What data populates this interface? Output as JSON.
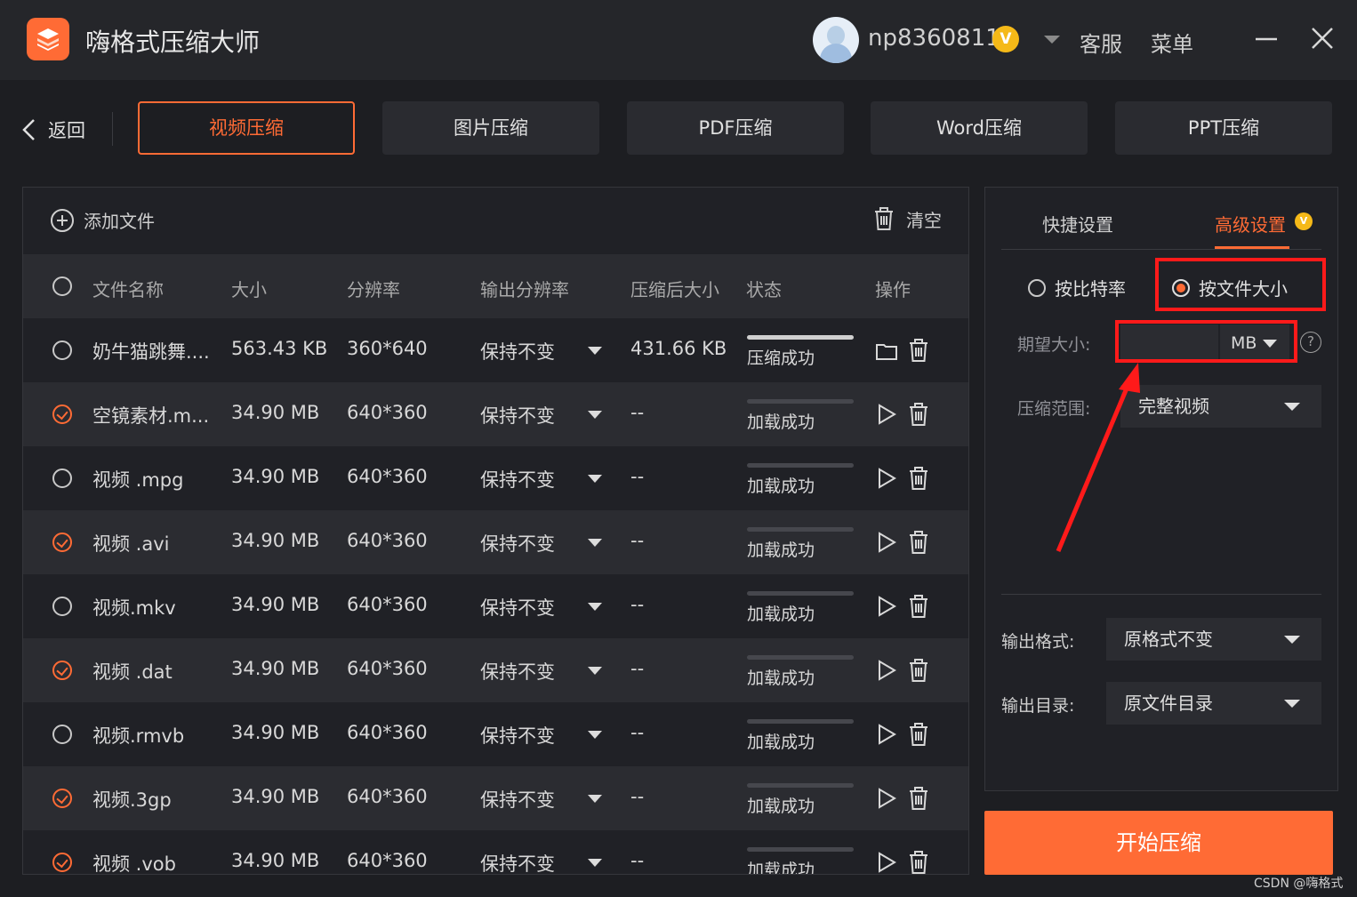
{
  "app": {
    "title": "嗨格式压缩大师"
  },
  "user": {
    "name": "np8360811",
    "vip_badge": "V",
    "service_label": "客服",
    "menu_label": "菜单"
  },
  "nav": {
    "back_label": "返回",
    "tabs": [
      {
        "label": "视频压缩",
        "active": true
      },
      {
        "label": "图片压缩",
        "active": false
      },
      {
        "label": "PDF压缩",
        "active": false
      },
      {
        "label": "Word压缩",
        "active": false
      },
      {
        "label": "PPT压缩",
        "active": false
      }
    ]
  },
  "file_panel": {
    "add_label": "添加文件",
    "clear_label": "清空",
    "columns": [
      "文件名称",
      "大小",
      "分辨率",
      "输出分辨率",
      "压缩后大小",
      "状态",
      "操作"
    ],
    "rows": [
      {
        "name": "奶牛猫跳舞....",
        "size": "563.43 KB",
        "resolution": "360*640",
        "output_resolution": "保持不变",
        "compressed_size": "431.66 KB",
        "status": "压缩成功",
        "checked": false
      },
      {
        "name": "空镜素材.m...",
        "size": "34.90 MB",
        "resolution": "640*360",
        "output_resolution": "保持不变",
        "compressed_size": "--",
        "status": "加载成功",
        "checked": true
      },
      {
        "name": "视频 .mpg",
        "size": "34.90 MB",
        "resolution": "640*360",
        "output_resolution": "保持不变",
        "compressed_size": "--",
        "status": "加载成功",
        "checked": false
      },
      {
        "name": "视频 .avi",
        "size": "34.90 MB",
        "resolution": "640*360",
        "output_resolution": "保持不变",
        "compressed_size": "--",
        "status": "加载成功",
        "checked": true
      },
      {
        "name": "视频.mkv",
        "size": "34.90 MB",
        "resolution": "640*360",
        "output_resolution": "保持不变",
        "compressed_size": "--",
        "status": "加载成功",
        "checked": false
      },
      {
        "name": "视频 .dat",
        "size": "34.90 MB",
        "resolution": "640*360",
        "output_resolution": "保持不变",
        "compressed_size": "--",
        "status": "加载成功",
        "checked": true
      },
      {
        "name": "视频.rmvb",
        "size": "34.90 MB",
        "resolution": "640*360",
        "output_resolution": "保持不变",
        "compressed_size": "--",
        "status": "加载成功",
        "checked": false
      },
      {
        "name": "视频.3gp",
        "size": "34.90 MB",
        "resolution": "640*360",
        "output_resolution": "保持不变",
        "compressed_size": "--",
        "status": "加载成功",
        "checked": true
      },
      {
        "name": "视频 .vob",
        "size": "34.90 MB",
        "resolution": "640*360",
        "output_resolution": "保持不变",
        "compressed_size": "--",
        "status": "加载成功",
        "checked": true
      }
    ]
  },
  "settings": {
    "tabs": [
      {
        "label": "快捷设置",
        "active": false
      },
      {
        "label": "高级设置",
        "active": true
      }
    ],
    "vip_badge": "V",
    "mode_options": [
      {
        "label": "按比特率",
        "selected": false
      },
      {
        "label": "按文件大小",
        "selected": true
      }
    ],
    "expected_size_label": "期望大小:",
    "expected_size_value": "",
    "unit": "MB",
    "help_glyph": "?",
    "range_label": "压缩范围:",
    "range_value": "完整视频",
    "output_format_label": "输出格式:",
    "output_format_value": "原格式不变",
    "output_dir_label": "输出目录:",
    "output_dir_value": "原文件目录"
  },
  "start_button": "开始压缩",
  "watermark": "CSDN @嗨格式",
  "colors": {
    "accent": "#ff6b35",
    "annotation_red": "#ff1a1a",
    "background": "#1d1e22",
    "panel": "#202126",
    "row_alt": "#2b2c31"
  }
}
